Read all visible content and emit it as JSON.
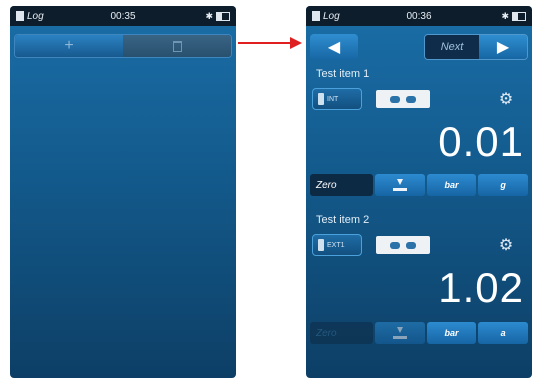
{
  "left_screen": {
    "status": {
      "app": "Log",
      "time": "00:35"
    },
    "toolbar": {
      "add_symbol": "+"
    }
  },
  "right_screen": {
    "status": {
      "app": "Log",
      "time": "00:36"
    },
    "nav": {
      "next_label": "Next"
    },
    "items": [
      {
        "title": "Test item 1",
        "sensor": "INT",
        "reading": "0.01",
        "zero": "Zero",
        "unit": "bar",
        "mode": "g"
      },
      {
        "title": "Test item 2",
        "sensor": "EXT1",
        "reading": "1.02",
        "zero": "Zero",
        "unit": "bar",
        "mode": "a"
      }
    ]
  },
  "colors": {
    "arrow": "#e02020",
    "accent": "#2d8bd0"
  }
}
